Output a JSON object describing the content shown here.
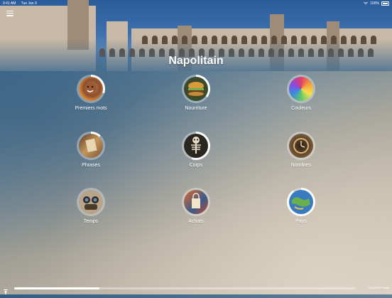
{
  "status": {
    "time": "9:41 AM",
    "date": "Tue Jan 9",
    "battery": "100%"
  },
  "header": {
    "title": "Napolitain"
  },
  "categories": [
    {
      "label": "Premiers mots",
      "progress": 0.3,
      "icon": "child-face-photo"
    },
    {
      "label": "Nourriture",
      "progress": 0.35,
      "icon": "burger-photo"
    },
    {
      "label": "Couleurs",
      "progress": 0.0,
      "icon": "paint-swirl-photo"
    },
    {
      "label": "Phrases",
      "progress": 0.12,
      "icon": "letter-photo"
    },
    {
      "label": "Corps",
      "progress": 0.55,
      "icon": "skeleton-photo"
    },
    {
      "label": "Nombres",
      "progress": 0.0,
      "icon": "number-clock-photo"
    },
    {
      "label": "Temps",
      "progress": 0.0,
      "icon": "weather-goggles-photo"
    },
    {
      "label": "Achats",
      "progress": 0.0,
      "icon": "shopping-photo"
    },
    {
      "label": "Pays",
      "progress": 0.9,
      "icon": "world-map-photo"
    }
  ],
  "footer": {
    "points": "806/2470 Points",
    "progress": 0.25
  },
  "colors": {
    "ring_done": "#ffffff",
    "ring_track": "rgba(255,255,255,0.35)"
  }
}
